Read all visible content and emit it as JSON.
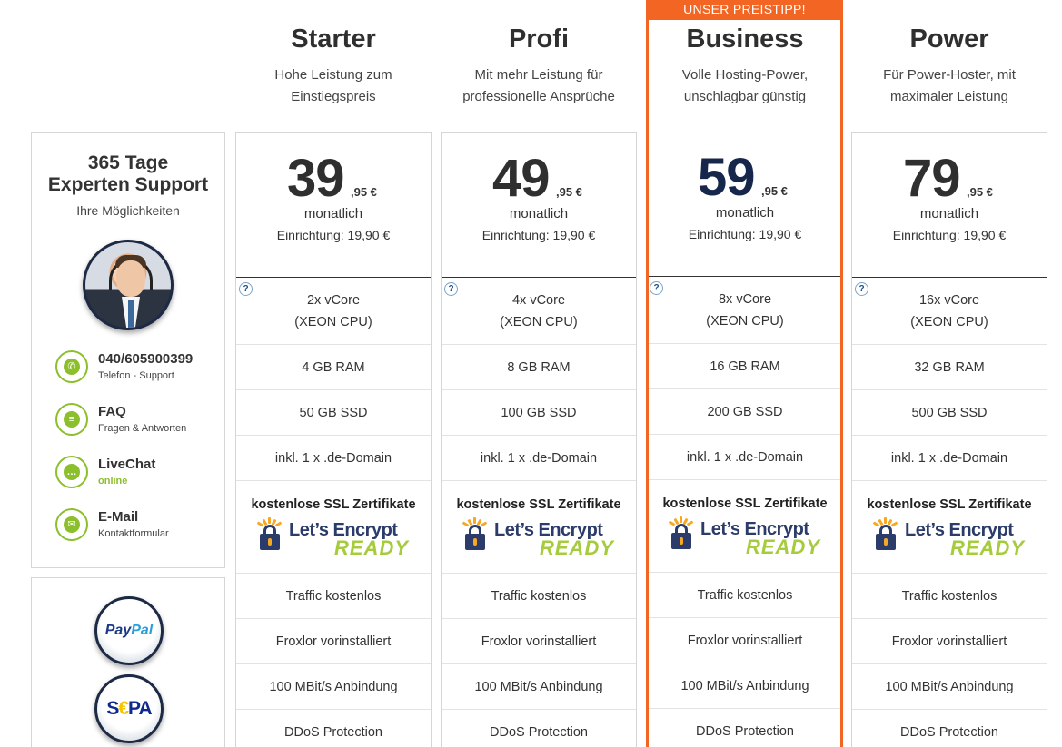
{
  "support": {
    "title_line1": "365 Tage",
    "title_line2": "Experten Support",
    "subtitle": "Ihre Möglichkeiten",
    "contacts": [
      {
        "label": "040/605900399",
        "sub": "Telefon - Support",
        "icon": "phone-icon"
      },
      {
        "label": "FAQ",
        "sub": "Fragen & Antworten",
        "icon": "list-icon"
      },
      {
        "label": "LiveChat",
        "sub": "online",
        "icon": "chat-icon"
      },
      {
        "label": "E-Mail",
        "sub": "Kontaktformular",
        "icon": "mail-icon"
      }
    ]
  },
  "payments": {
    "paypal_pay": "Pay",
    "paypal_pal": "Pal",
    "sepa_s": "S",
    "sepa_euro": "€",
    "sepa_pa": "PA"
  },
  "highlight_banner": "UNSER PREISTIPP!",
  "colors": {
    "accent_orange": "#f26522",
    "accent_green": "#8cbf2c",
    "price_highlight": "#17274b"
  },
  "plans": [
    {
      "name": "Starter",
      "desc_line1": "Hohe Leistung zum",
      "desc_line2": "Einstiegspreis",
      "price": "39",
      "cents": ",95 €",
      "period": "monatlich",
      "setup": "Einrichtung: 19,90 €",
      "cpu_line1": "2x vCore",
      "cpu_line2": "(XEON CPU)",
      "ram": "4 GB RAM",
      "ssd": "50 GB SSD",
      "domain": "inkl. 1 x .de-Domain",
      "ssl": "kostenlose SSL Zertifikate",
      "traffic": "Traffic kostenlos",
      "panel": "Froxlor vorinstalliert",
      "network": "100 MBit/s Anbindung",
      "ddos": "DDoS Protection"
    },
    {
      "name": "Profi",
      "desc_line1": "Mit mehr Leistung für",
      "desc_line2": "professionelle Ansprüche",
      "price": "49",
      "cents": ",95 €",
      "period": "monatlich",
      "setup": "Einrichtung: 19,90 €",
      "cpu_line1": "4x vCore",
      "cpu_line2": "(XEON CPU)",
      "ram": "8 GB RAM",
      "ssd": "100 GB SSD",
      "domain": "inkl. 1 x .de-Domain",
      "ssl": "kostenlose SSL Zertifikate",
      "traffic": "Traffic kostenlos",
      "panel": "Froxlor vorinstalliert",
      "network": "100 MBit/s Anbindung",
      "ddos": "DDoS Protection"
    },
    {
      "name": "Business",
      "desc_line1": "Volle Hosting-Power,",
      "desc_line2": "unschlagbar günstig",
      "price": "59",
      "cents": ",95 €",
      "period": "monatlich",
      "setup": "Einrichtung: 19,90 €",
      "cpu_line1": "8x vCore",
      "cpu_line2": "(XEON CPU)",
      "ram": "16 GB RAM",
      "ssd": "200 GB SSD",
      "domain": "inkl. 1 x .de-Domain",
      "ssl": "kostenlose SSL Zertifikate",
      "traffic": "Traffic kostenlos",
      "panel": "Froxlor vorinstalliert",
      "network": "100 MBit/s Anbindung",
      "ddos": "DDoS Protection"
    },
    {
      "name": "Power",
      "desc_line1": "Für Power-Hoster, mit",
      "desc_line2": "maximaler Leistung",
      "price": "79",
      "cents": ",95 €",
      "period": "monatlich",
      "setup": "Einrichtung: 19,90 €",
      "cpu_line1": "16x vCore",
      "cpu_line2": "(XEON CPU)",
      "ram": "32 GB RAM",
      "ssd": "500 GB SSD",
      "domain": "inkl. 1 x .de-Domain",
      "ssl": "kostenlose SSL Zertifikate",
      "traffic": "Traffic kostenlos",
      "panel": "Froxlor vorinstalliert",
      "network": "100 MBit/s Anbindung",
      "ddos": "DDoS Protection"
    }
  ],
  "letsencrypt": {
    "brand": "Let’s Encrypt",
    "ready": "READY"
  },
  "info_symbol": "?"
}
